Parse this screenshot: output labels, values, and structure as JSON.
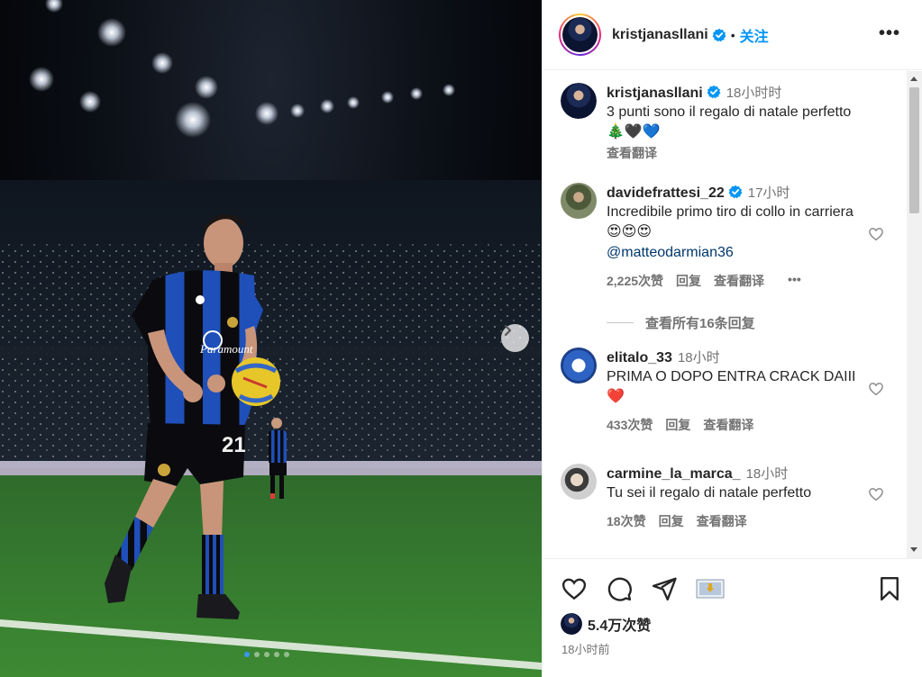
{
  "post": {
    "username": "kristjanasllani",
    "follow_label": "关注",
    "separator": "•",
    "more_label": "•••",
    "likes": "5.4万次赞",
    "posted_ago": "18小时前",
    "carousel_count": 5,
    "carousel_active_index": 0,
    "player_number": "21"
  },
  "caption": {
    "username": "kristjanasllani",
    "time": "18小时时",
    "text": "3 punti sono il regalo di natale perfetto 🎄🖤💙",
    "translate": "查看翻译"
  },
  "comments": [
    {
      "username": "davidefrattesi_22",
      "verified": true,
      "time": "17小时",
      "text": "Incredibile primo tiro di collo in carriera 😍😍😍",
      "mention": "@matteodarmian36",
      "likes": "2,225次赞",
      "reply": "回复",
      "translate": "查看翻译",
      "more": "•••"
    },
    {
      "username": "elitalo_33",
      "verified": false,
      "time": "18小时",
      "text": "PRIMA O DOPO ENTRA CRACK DAIII ❤️",
      "likes": "433次赞",
      "reply": "回复",
      "translate": "查看翻译"
    },
    {
      "username": "carmine_la_marca_",
      "verified": false,
      "time": "18小时",
      "text": "Tu sei il regalo di natale perfetto",
      "likes": "18次赞",
      "reply": "回复",
      "translate": "查看翻译"
    }
  ],
  "view_replies": "查看所有16条回复",
  "colors": {
    "follow_blue": "#0095f6",
    "verified_blue": "#0095f6",
    "muted_text": "#737373",
    "mention": "#00376b",
    "heart_red": "#e0245e"
  },
  "icons": {
    "like": "heart-outline-icon",
    "comment": "speech-bubble-icon",
    "share": "paper-plane-icon",
    "gift": "gift-icon",
    "save": "bookmark-icon",
    "next": "chevron-right-icon"
  }
}
